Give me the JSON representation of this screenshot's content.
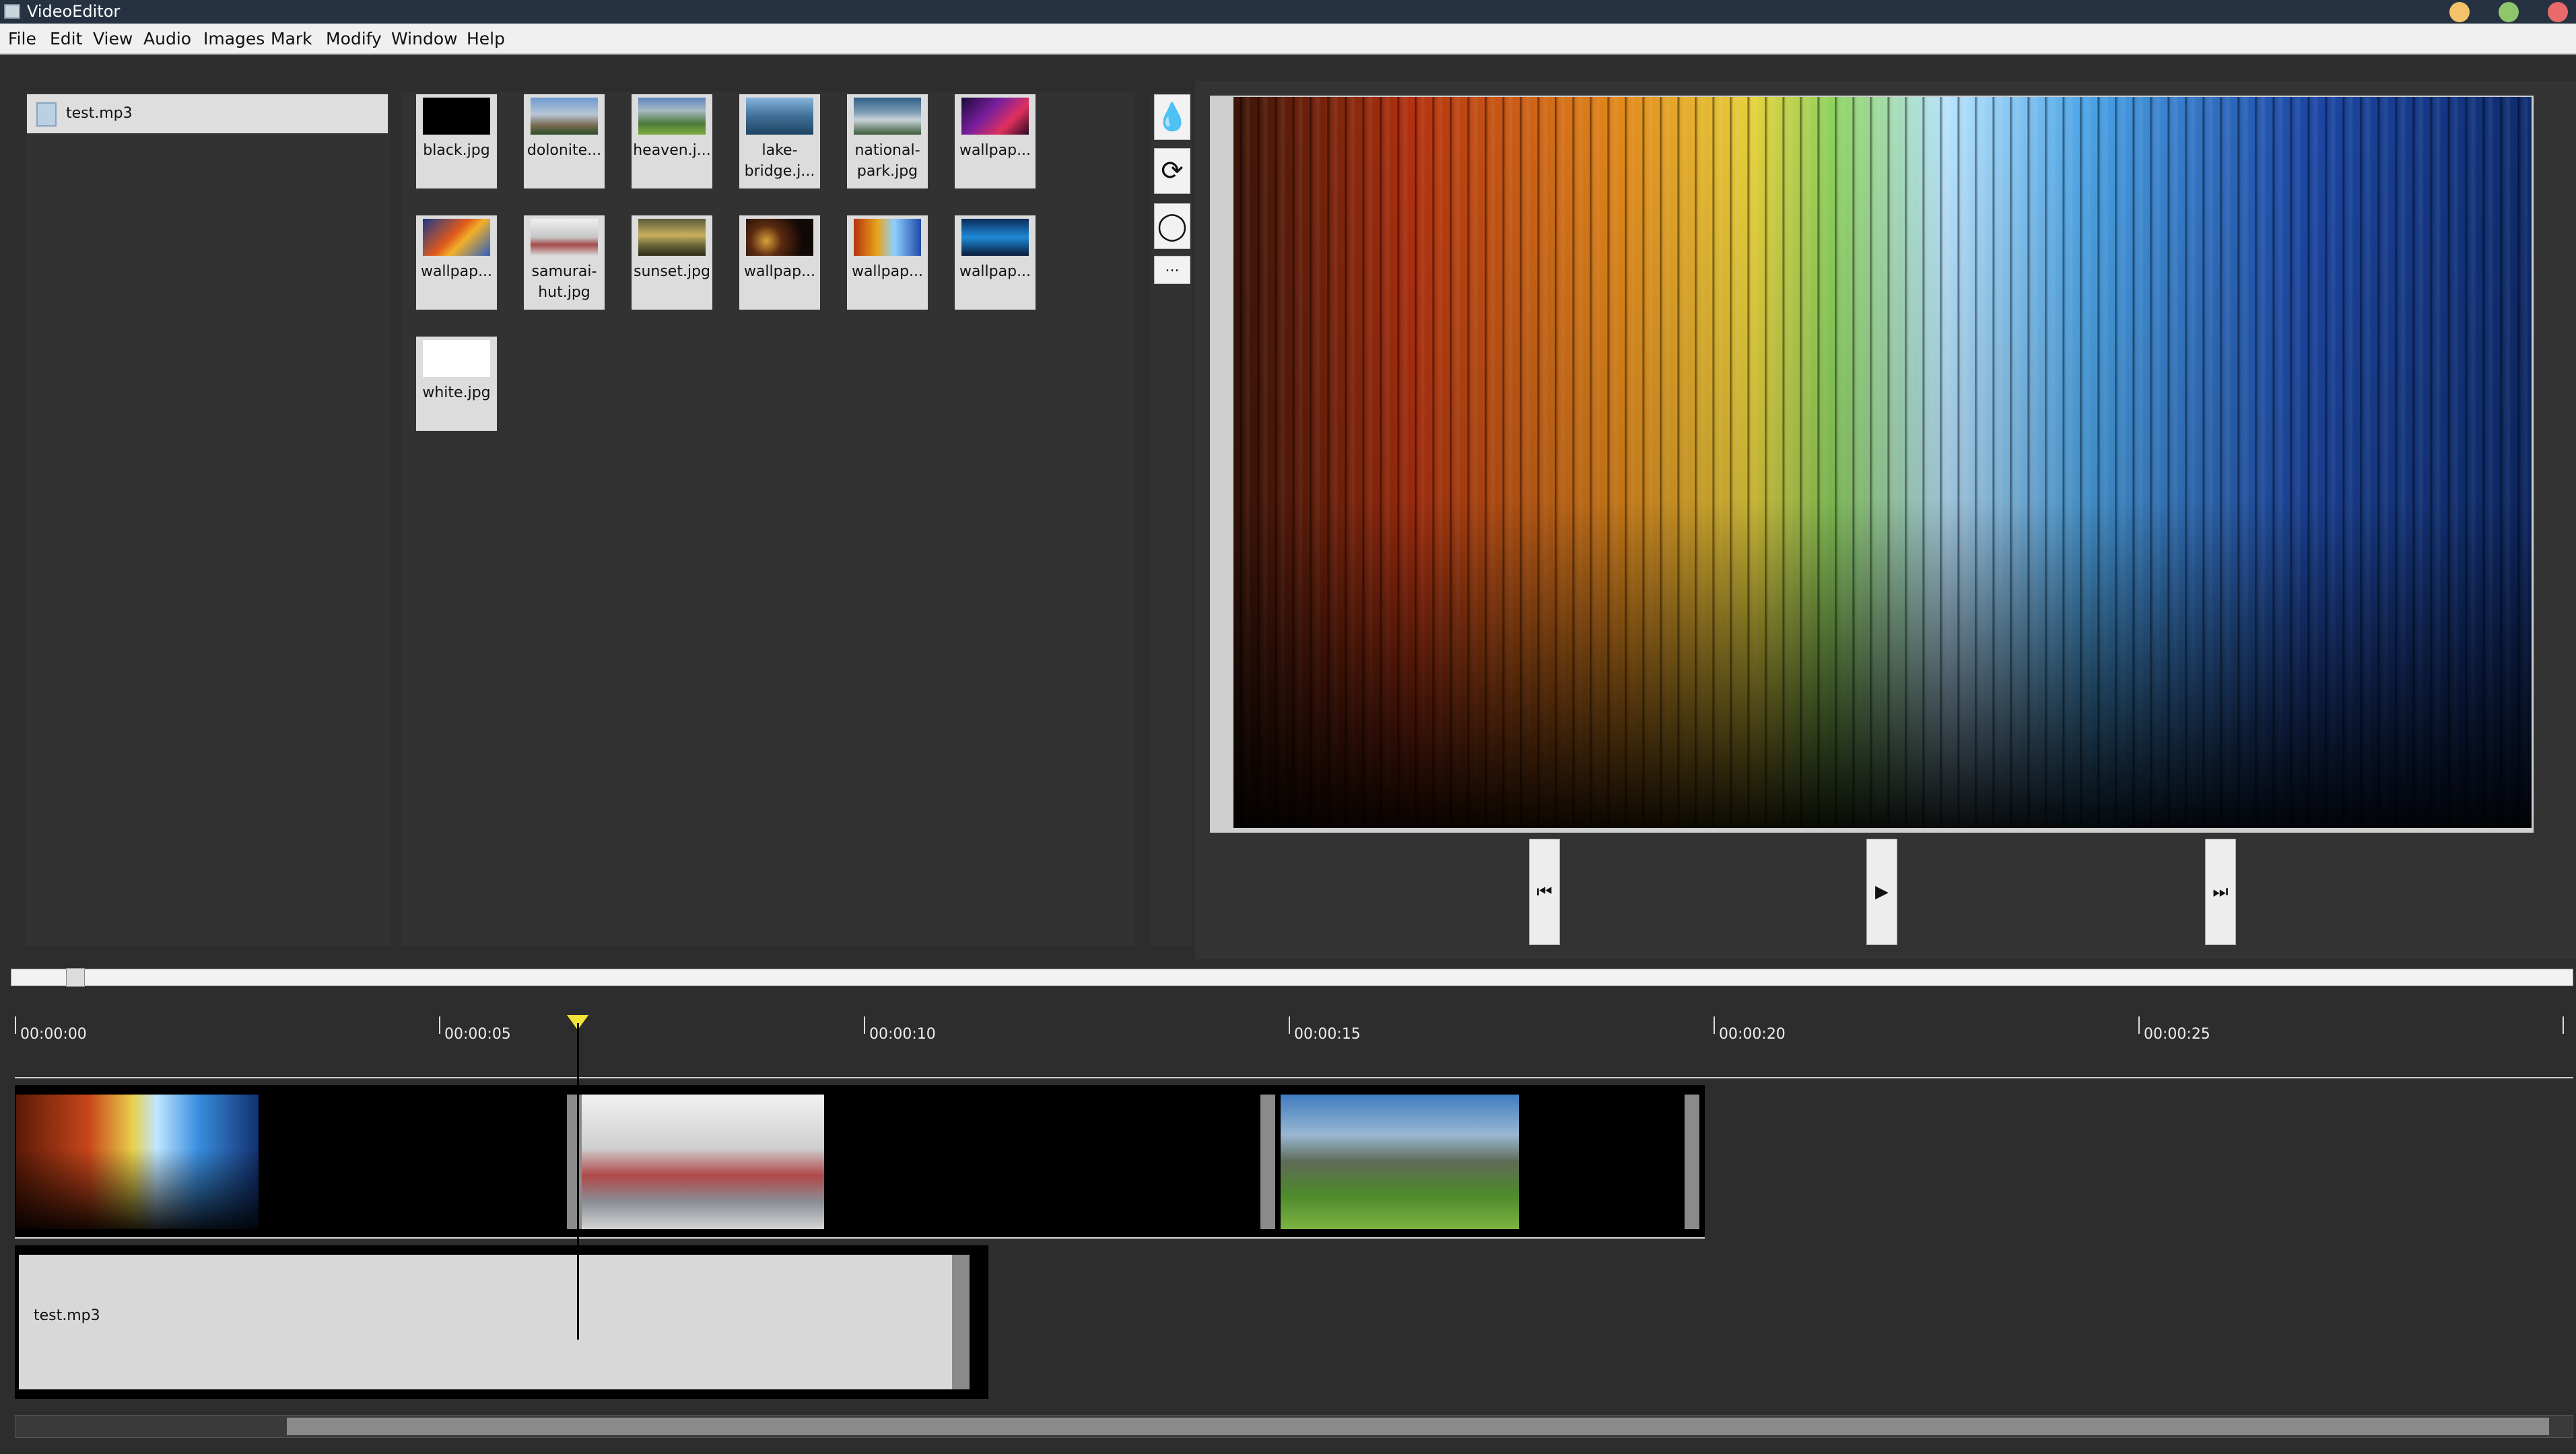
{
  "window": {
    "title": "VideoEditor"
  },
  "menu": [
    "File",
    "Edit",
    "View",
    "Audio",
    "Images",
    "Mark",
    "Modify",
    "Window",
    "Help"
  ],
  "audio_files": [
    {
      "name": "test.mp3"
    }
  ],
  "images": [
    {
      "name": "black.jpg",
      "icon": "black-thumbnail"
    },
    {
      "name": "dolonite...",
      "icon": "mountains-thumbnail"
    },
    {
      "name": "heaven.j...",
      "icon": "valley-thumbnail"
    },
    {
      "name": "lake-\nbridge.j...",
      "icon": "lake-bridge-thumbnail"
    },
    {
      "name": "national-\npark.jpg",
      "icon": "park-thumbnail"
    },
    {
      "name": "wallpap...",
      "icon": "purple-wallpaper-thumbnail"
    },
    {
      "name": "wallpap...",
      "icon": "abstract-wallpaper-thumbnail"
    },
    {
      "name": "samurai-\nhut.jpg",
      "icon": "samurai-hut-thumbnail"
    },
    {
      "name": "sunset.jpg",
      "icon": "sunset-thumbnail"
    },
    {
      "name": "wallpap...",
      "icon": "bokeh-wallpaper-thumbnail"
    },
    {
      "name": "wallpap...",
      "icon": "spectrum-wallpaper-thumbnail"
    },
    {
      "name": "wallpap...",
      "icon": "blue-wallpaper-thumbnail"
    },
    {
      "name": "white.jpg",
      "icon": "white-thumbnail"
    }
  ],
  "tools": [
    {
      "icon": "drop-icon",
      "glyph": "💧"
    },
    {
      "icon": "rotate-icon",
      "glyph": "⟳"
    },
    {
      "icon": "circle-icon",
      "glyph": "◯"
    },
    {
      "icon": "more-icon",
      "glyph": "..."
    }
  ],
  "playback": {
    "prev_glyph": "⏮",
    "play_glyph": "▶",
    "next_glyph": "⏭"
  },
  "timeline": {
    "ticks": [
      "00:00:00",
      "00:00:05",
      "00:00:10",
      "00:00:15",
      "00:00:20",
      "00:00:25"
    ],
    "playhead_time_s": 6.7,
    "audio_clip_label": "test.mp3",
    "colors": {
      "playhead": "#f5e236"
    }
  }
}
